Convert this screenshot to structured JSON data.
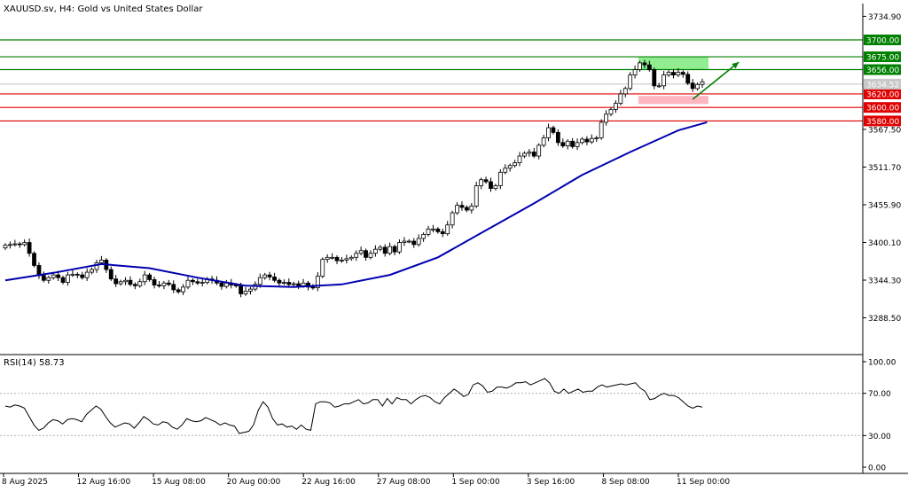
{
  "chart_data": [
    {
      "type": "candlestick",
      "title": "XAUUSD.sv, H4:  Gold vs United States Dollar",
      "ylim": [
        3255,
        3760
      ],
      "y_ticks": [
        {
          "label": "3734.90",
          "value": 3734.9
        },
        {
          "label": "3567.50",
          "value": 3567.5
        },
        {
          "label": "3511.70",
          "value": 3511.7
        },
        {
          "label": "3455.90",
          "value": 3455.9
        },
        {
          "label": "3400.10",
          "value": 3400.1
        },
        {
          "label": "3344.30",
          "value": 3344.3
        },
        {
          "label": "3288.50",
          "value": 3288.5
        }
      ],
      "x_ticks": [
        "8 Aug 2025",
        "12 Aug 16:00",
        "15 Aug 08:00",
        "20 Aug 00:00",
        "22 Aug 16:00",
        "27 Aug 08:00",
        "1 Sep 00:00",
        "3 Sep 16:00",
        "8 Sep 08:00",
        "11 Sep 00:00"
      ],
      "levels": [
        {
          "value": 3700,
          "label": "3700.00",
          "color": "#008000"
        },
        {
          "value": 3675,
          "label": "3675.00",
          "color": "#008000"
        },
        {
          "value": 3656,
          "label": "3656.00",
          "color": "#008000"
        },
        {
          "value": 3620,
          "label": "3620.00",
          "color": "#e00000"
        },
        {
          "value": 3600,
          "label": "3600.00",
          "color": "#e00000"
        },
        {
          "value": 3580,
          "label": "3580.00",
          "color": "#e00000"
        }
      ],
      "current_price": {
        "value": 3634.52,
        "label": "3634.52"
      },
      "zones": [
        {
          "y_from": 3656,
          "y_to": 3675,
          "color": "#90ee90"
        },
        {
          "y_from": 3605,
          "y_to": 3617,
          "color": "#ffb6c1"
        }
      ],
      "closes": [
        3396,
        3397,
        3398,
        3397,
        3400,
        3384,
        3366,
        3351,
        3344,
        3348,
        3352,
        3348,
        3341,
        3352,
        3353,
        3352,
        3348,
        3356,
        3360,
        3370,
        3374,
        3360,
        3346,
        3339,
        3342,
        3344,
        3338,
        3336,
        3342,
        3352,
        3345,
        3337,
        3336,
        3340,
        3338,
        3330,
        3327,
        3334,
        3344,
        3342,
        3340,
        3341,
        3346,
        3344,
        3340,
        3335,
        3340,
        3337,
        3336,
        3324,
        3328,
        3331,
        3338,
        3348,
        3352,
        3349,
        3344,
        3340,
        3341,
        3338,
        3339,
        3336,
        3340,
        3334,
        3333,
        3350,
        3375,
        3378,
        3378,
        3373,
        3374,
        3376,
        3378,
        3384,
        3388,
        3378,
        3384,
        3390,
        3393,
        3384,
        3394,
        3386,
        3400,
        3402,
        3402,
        3397,
        3406,
        3412,
        3420,
        3420,
        3416,
        3413,
        3426,
        3444,
        3455,
        3452,
        3448,
        3454,
        3484,
        3493,
        3490,
        3480,
        3484,
        3504,
        3510,
        3514,
        3518,
        3528,
        3532,
        3534,
        3528,
        3544,
        3555,
        3570,
        3563,
        3548,
        3543,
        3550,
        3542,
        3548,
        3553,
        3549,
        3554,
        3555,
        3578,
        3590,
        3597,
        3606,
        3620,
        3628,
        3648,
        3656,
        3666,
        3663,
        3656,
        3632,
        3632,
        3648,
        3652,
        3648,
        3652,
        3649,
        3636,
        3628,
        3634,
        3638
      ],
      "ma": {
        "name": "",
        "color": "#0000b0",
        "anchors": [
          [
            0,
            3344
          ],
          [
            10,
            3355
          ],
          [
            20,
            3368
          ],
          [
            30,
            3362
          ],
          [
            40,
            3348
          ],
          [
            50,
            3336
          ],
          [
            60,
            3334
          ],
          [
            70,
            3338
          ],
          [
            80,
            3352
          ],
          [
            90,
            3378
          ],
          [
            100,
            3418
          ],
          [
            110,
            3458
          ],
          [
            120,
            3500
          ],
          [
            130,
            3534
          ],
          [
            140,
            3566
          ],
          [
            146,
            3578
          ]
        ]
      },
      "trend_arrow": {
        "from": [
          143,
          3612
        ],
        "to": [
          150,
          3667
        ],
        "color": "#008000"
      }
    },
    {
      "type": "line",
      "title": "RSI(14) 58.73",
      "ylim": [
        0,
        100
      ],
      "y_ticks": [
        {
          "label": "100.00",
          "value": 100
        },
        {
          "label": "70.00",
          "value": 70
        },
        {
          "label": "30.00",
          "value": 30
        },
        {
          "label": "0.00",
          "value": 0
        }
      ],
      "levels": [
        70,
        30
      ],
      "values": [
        58,
        57,
        59,
        58,
        56,
        48,
        40,
        35,
        37,
        42,
        45,
        44,
        41,
        45,
        46,
        45,
        43,
        50,
        54,
        58,
        55,
        48,
        42,
        38,
        40,
        42,
        41,
        37,
        42,
        48,
        45,
        41,
        40,
        43,
        42,
        38,
        36,
        40,
        46,
        44,
        43,
        44,
        47,
        45,
        43,
        40,
        42,
        40,
        39,
        32,
        33,
        34,
        40,
        54,
        62,
        57,
        46,
        40,
        41,
        38,
        39,
        36,
        40,
        36,
        35,
        60,
        62,
        62,
        61,
        57,
        58,
        60,
        60,
        62,
        64,
        60,
        61,
        64,
        64,
        58,
        65,
        60,
        66,
        64,
        64,
        60,
        64,
        67,
        68,
        66,
        62,
        60,
        66,
        70,
        74,
        71,
        67,
        69,
        78,
        80,
        77,
        71,
        72,
        76,
        76,
        75,
        77,
        80,
        80,
        81,
        78,
        80,
        82,
        84,
        80,
        72,
        70,
        74,
        70,
        72,
        74,
        71,
        72,
        72,
        76,
        78,
        76,
        77,
        78,
        79,
        78,
        79,
        80,
        75,
        72,
        64,
        65,
        68,
        70,
        68,
        68,
        66,
        62,
        58,
        56,
        58,
        57
      ]
    }
  ]
}
